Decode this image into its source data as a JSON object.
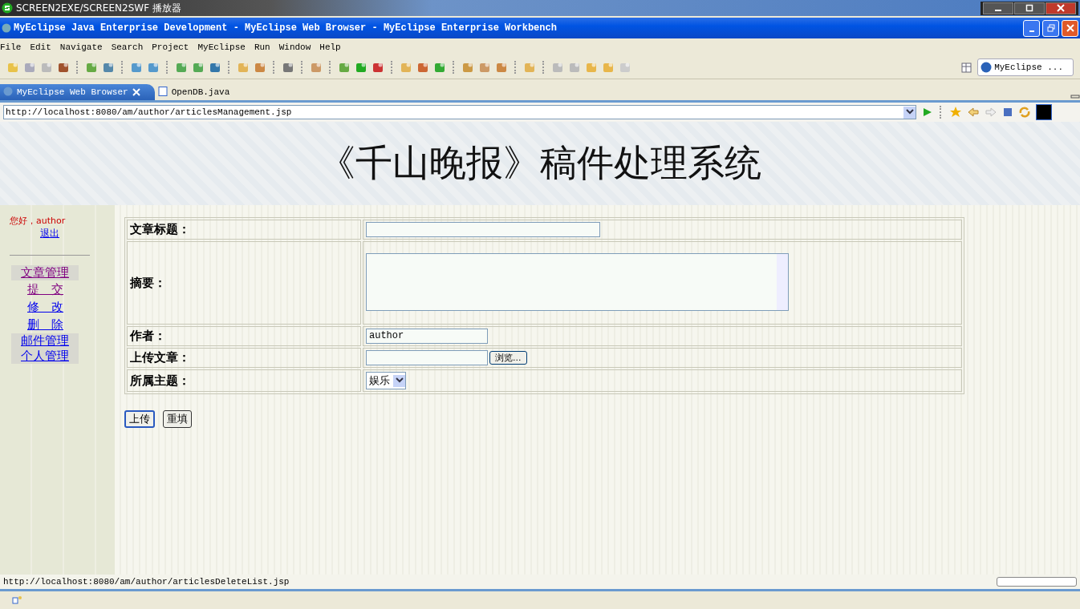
{
  "player": {
    "title": "SCREEN2EXE/SCREEN2SWF 播放器"
  },
  "window": {
    "title": "MyEclipse Java Enterprise Development - MyEclipse Web Browser - MyEclipse Enterprise Workbench"
  },
  "menu": [
    "File",
    "Edit",
    "Navigate",
    "Search",
    "Project",
    "MyEclipse",
    "Run",
    "Window",
    "Help"
  ],
  "perspective": {
    "label": "MyEclipse ..."
  },
  "tabs": [
    {
      "label": "MyEclipse Web Browser",
      "selected": true,
      "closable": true
    },
    {
      "label": "OpenDB.java",
      "selected": false,
      "closable": false
    }
  ],
  "address": {
    "value": "http://localhost:8080/am/author/articlesManagement.jsp"
  },
  "page": {
    "title": "《千山晚报》稿件处理系统",
    "greeting": "您好，author",
    "logout": "退出",
    "nav": [
      {
        "label": "文章管理",
        "visited": true,
        "children": [
          {
            "label": "提　交",
            "visited": true
          },
          {
            "label": "修　改",
            "visited": false
          },
          {
            "label": "删　除",
            "visited": false
          }
        ]
      },
      {
        "label": "邮件管理",
        "visited": false
      },
      {
        "label": "个人管理",
        "visited": false
      }
    ],
    "form": [
      {
        "kind": "text",
        "label": "文章标题："
      },
      {
        "kind": "textarea",
        "label": "摘要："
      },
      {
        "kind": "text-short",
        "label": "作者：",
        "value": "author"
      },
      {
        "kind": "file",
        "label": "上传文章：",
        "button": "浏览..."
      },
      {
        "kind": "select",
        "label": "所属主题：",
        "value": "娱乐"
      }
    ],
    "buttons": [
      {
        "label": "上传",
        "focused": true
      },
      {
        "label": "重填",
        "focused": false
      }
    ]
  },
  "status_bar": {
    "text": "http://localhost:8080/am/author/articlesDeleteList.jsp",
    "progress": {
      "level": 0
    }
  }
}
